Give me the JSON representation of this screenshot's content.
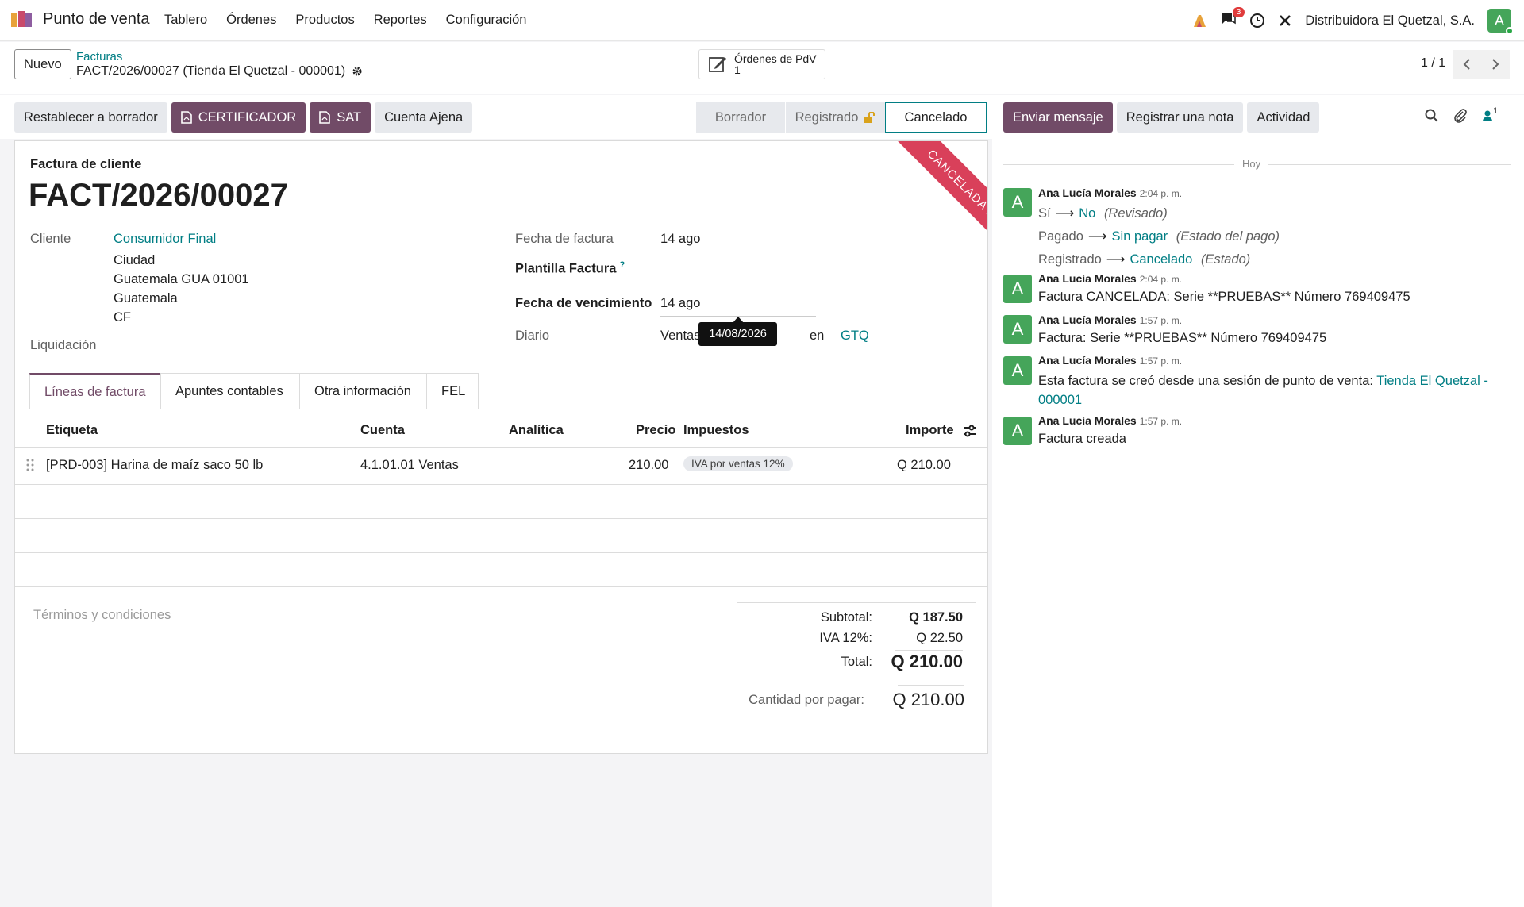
{
  "navbar": {
    "app_name": "Punto de venta",
    "menu": [
      "Tablero",
      "Órdenes",
      "Productos",
      "Reportes",
      "Configuración"
    ],
    "messages_badge": "3",
    "company": "Distribuidora El Quetzal, S.A.",
    "user_initial": "A"
  },
  "control": {
    "new_button": "Nuevo",
    "breadcrumb_parent": "Facturas",
    "breadcrumb_current": "FACT/2026/00027 (Tienda El Quetzal - 000001)",
    "smart_button_label": "Órdenes de PdV",
    "smart_button_count": "1",
    "pager": "1 / 1"
  },
  "actions": {
    "reset_draft": "Restablecer a borrador",
    "certifier": "CERTIFICADOR",
    "sat": "SAT",
    "third_party": "Cuenta Ajena",
    "status_steps": [
      "Borrador",
      "Registrado",
      "Cancelado"
    ],
    "active_status": "Cancelado"
  },
  "chatter_buttons": {
    "send_message": "Enviar mensaje",
    "log_note": "Registrar una nota",
    "activity": "Actividad",
    "followers_count": "1"
  },
  "form": {
    "type_label": "Factura de cliente",
    "number": "FACT/2026/00027",
    "ribbon": "CANCELADA FEL",
    "customer_label": "Cliente",
    "customer_name": "Consumidor Final",
    "customer_address": [
      "Ciudad",
      "Guatemala GUA 01001",
      "Guatemala",
      "CF"
    ],
    "settlement_label": "Liquidación",
    "invoice_date_label": "Fecha de factura",
    "invoice_date": "14 ago",
    "template_label": "Plantilla Factura",
    "template_help": "?",
    "due_date_label": "Fecha de vencimiento",
    "due_date": "14 ago",
    "tooltip": "14/08/2026",
    "journal_label": "Diario",
    "journal_value": "Ventas",
    "currency_in": "en",
    "currency": "GTQ"
  },
  "tabs": [
    "Líneas de factura",
    "Apuntes contables",
    "Otra información",
    "FEL"
  ],
  "lines_table": {
    "headers": {
      "label": "Etiqueta",
      "account": "Cuenta",
      "analytic": "Analítica",
      "price": "Precio",
      "taxes": "Impuestos",
      "amount": "Importe"
    },
    "rows": [
      {
        "label": "[PRD-003] Harina de maíz saco 50 lb",
        "account": "4.1.01.01 Ventas",
        "analytic": "",
        "price": "210.00",
        "taxes": "IVA por ventas 12%",
        "amount": "Q 210.00"
      }
    ]
  },
  "terms_placeholder": "Términos y condiciones",
  "totals": {
    "subtotal_label": "Subtotal:",
    "subtotal": "Q 187.50",
    "tax_label": "IVA 12%:",
    "tax": "Q 22.50",
    "total_label": "Total:",
    "total": "Q 210.00",
    "due_label": "Cantidad por pagar:",
    "due": "Q 210.00"
  },
  "chatter": {
    "date_separator": "Hoy",
    "messages": [
      {
        "author": "Ana Lucía Morales",
        "time": "2:04 p. m.",
        "tracking": [
          {
            "old": "Sí",
            "new": "No",
            "field": "(Revisado)"
          },
          {
            "old": "Pagado",
            "new": "Sin pagar",
            "field": "(Estado del pago)"
          },
          {
            "old": "Registrado",
            "new": "Cancelado",
            "field": "(Estado)"
          }
        ]
      },
      {
        "author": "Ana Lucía Morales",
        "time": "2:04 p. m.",
        "body": "Factura CANCELADA: Serie **PRUEBAS** Número 769409475"
      },
      {
        "author": "Ana Lucía Morales",
        "time": "1:57 p. m.",
        "body": "Factura: Serie **PRUEBAS** Número 769409475"
      },
      {
        "author": "Ana Lucía Morales",
        "time": "1:57 p. m.",
        "body": "Esta factura se creó desde una sesión de punto de venta:",
        "link": "Tienda El Quetzal - 000001"
      },
      {
        "author": "Ana Lucía Morales",
        "time": "1:57 p. m.",
        "body": "Factura creada"
      }
    ],
    "avatar_initial": "A"
  },
  "colors": {
    "brand": "#714b67",
    "link": "#017e84",
    "ribbon": "#d9405a",
    "avatar": "#45a55a"
  }
}
